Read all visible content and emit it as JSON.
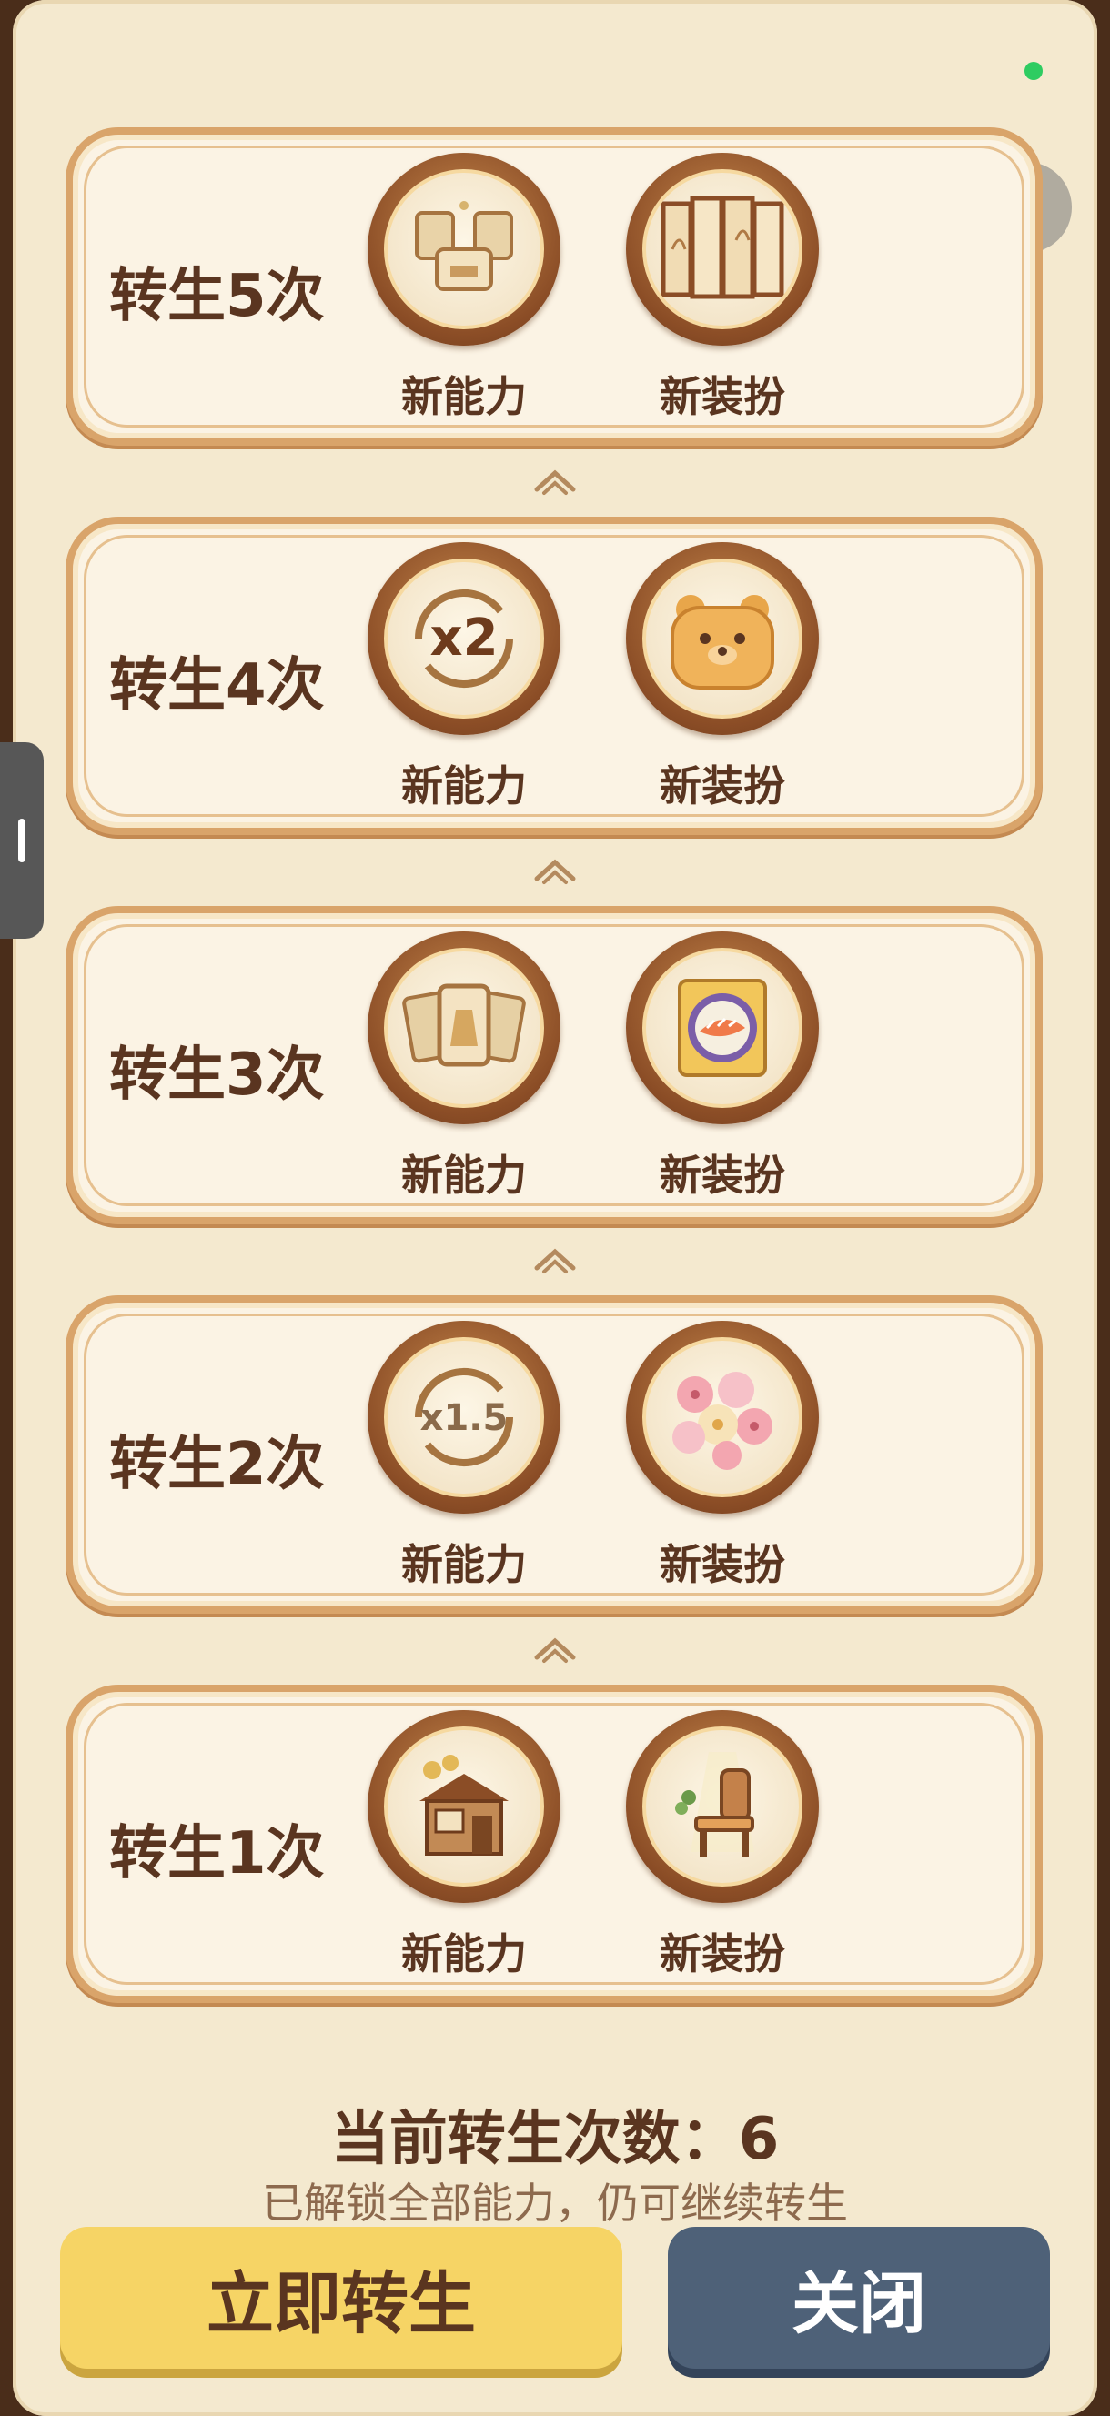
{
  "rebirth_tiers": [
    {
      "title": "转生5次",
      "rewards": [
        {
          "label": "新能力",
          "icon": "outfit-cards-icon"
        },
        {
          "label": "新装扮",
          "icon": "folding-screen-icon"
        }
      ]
    },
    {
      "title": "转生4次",
      "rewards": [
        {
          "label": "新能力",
          "icon": "x2-multiplier-icon",
          "badge": "x2"
        },
        {
          "label": "新装扮",
          "icon": "bear-cushion-icon"
        }
      ]
    },
    {
      "title": "转生3次",
      "rewards": [
        {
          "label": "新能力",
          "icon": "dress-cards-icon"
        },
        {
          "label": "新装扮",
          "icon": "salmon-sushi-plate-icon"
        }
      ]
    },
    {
      "title": "转生2次",
      "rewards": [
        {
          "label": "新能力",
          "icon": "x1.5-multiplier-icon",
          "badge": "x1.5"
        },
        {
          "label": "新装扮",
          "icon": "flower-bouquet-icon"
        }
      ]
    },
    {
      "title": "转生1次",
      "rewards": [
        {
          "label": "新能力",
          "icon": "shop-coins-icon"
        },
        {
          "label": "新装扮",
          "icon": "wooden-chair-icon"
        }
      ]
    }
  ],
  "summary": {
    "count_text": "当前转生次数：6",
    "note": "已解锁全部能力，仍可继续转生"
  },
  "buttons": {
    "rebirth_now": "立即转生",
    "close": "关闭"
  },
  "capsule": {
    "more": "•••"
  },
  "colors": {
    "primary_button": "#f6d465",
    "secondary_button": "#4e6178",
    "text_brown": "#5a3520",
    "card_border": "#d9a46a"
  }
}
